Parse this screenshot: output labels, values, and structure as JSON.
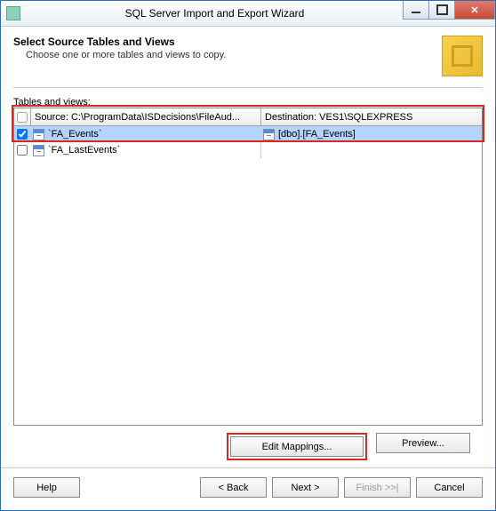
{
  "window": {
    "title": "SQL Server Import and Export Wizard"
  },
  "header": {
    "title": "Select Source Tables and Views",
    "subtitle": "Choose one or more tables and views to copy."
  },
  "tables_label_pre": "T",
  "tables_label_char": "a",
  "tables_label_post": "bles and views:",
  "columns": {
    "source": "Source: C:\\ProgramData\\ISDecisions\\FileAud...",
    "destination": "Destination: VES1\\SQLEXPRESS"
  },
  "rows": [
    {
      "checked": true,
      "selected": true,
      "source": "`FA_Events`",
      "dest": "[dbo].[FA_Events]"
    },
    {
      "checked": false,
      "selected": false,
      "source": "`FA_LastEvents`",
      "dest": ""
    }
  ],
  "buttons": {
    "edit_mappings": "Edit Mappings...",
    "preview": "Preview...",
    "help": "Help",
    "back": "< Back",
    "next": "Next >",
    "finish": "Finish >>|",
    "cancel": "Cancel"
  }
}
